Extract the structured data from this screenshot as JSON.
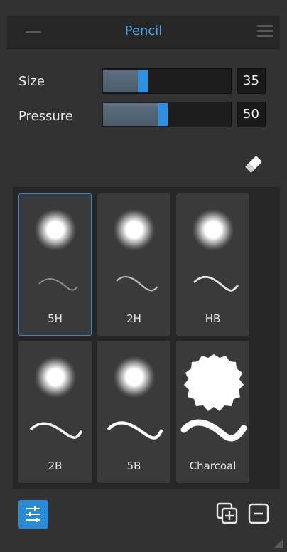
{
  "panel": {
    "title": "Pencil"
  },
  "controls": {
    "size": {
      "label": "Size",
      "value": "35",
      "fraction": 0.35
    },
    "pressure": {
      "label": "Pressure",
      "value": "50",
      "fraction": 0.5
    }
  },
  "presets": [
    {
      "label": "5H",
      "selected": true
    },
    {
      "label": "2H",
      "selected": false
    },
    {
      "label": "HB",
      "selected": false
    },
    {
      "label": "2B",
      "selected": false
    },
    {
      "label": "5B",
      "selected": false
    },
    {
      "label": "Charcoal",
      "selected": false
    }
  ],
  "colors": {
    "accent": "#2b8ad8",
    "title": "#4da3e8",
    "background": "#323232"
  },
  "icons": {
    "collapse": "minus-icon",
    "menu": "hamburger-menu-icon",
    "eraser": "eraser-icon",
    "settings": "sliders-icon",
    "duplicate": "duplicate-preset-icon",
    "remove": "remove-preset-icon",
    "resize": "resize-grip-icon"
  }
}
